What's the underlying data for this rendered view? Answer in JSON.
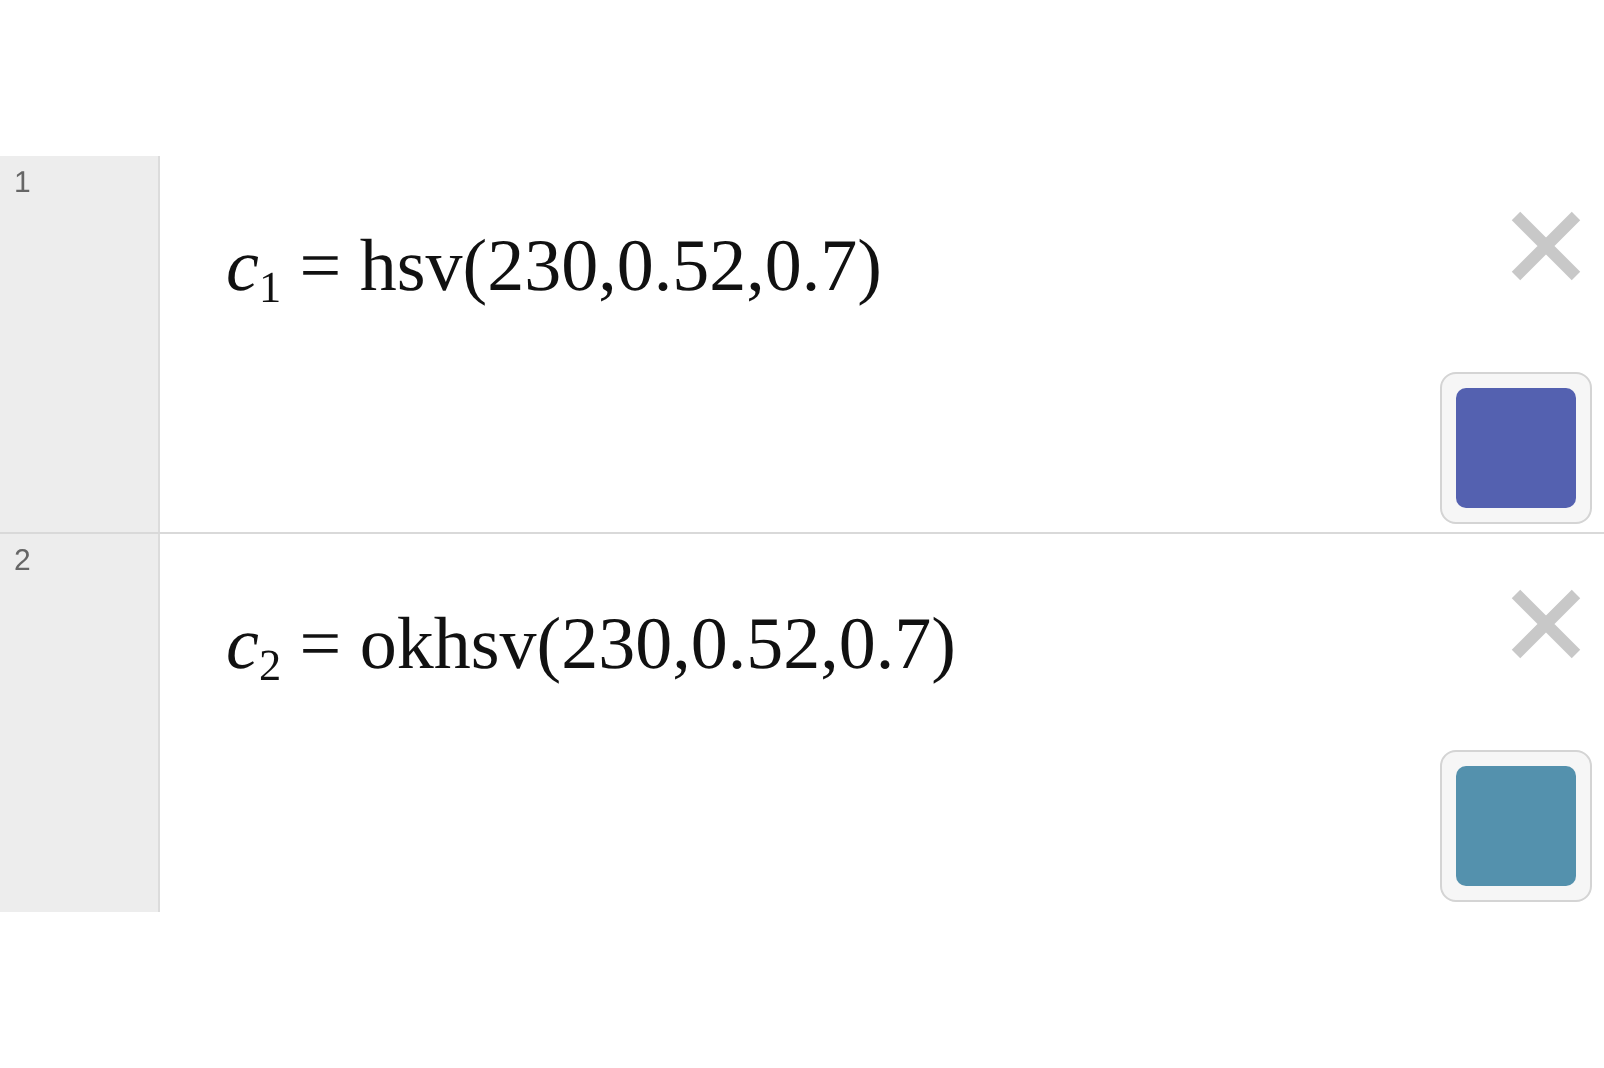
{
  "expressions": [
    {
      "number": "1",
      "formula": "*c*$_{1}$ = hsv(230,0.52,0.7)",
      "color": "#5461b0"
    },
    {
      "number": "2",
      "formula": "*c*$_{2}$ = okhsv(230,0.52,0.7)",
      "color": "#5491ad"
    }
  ]
}
